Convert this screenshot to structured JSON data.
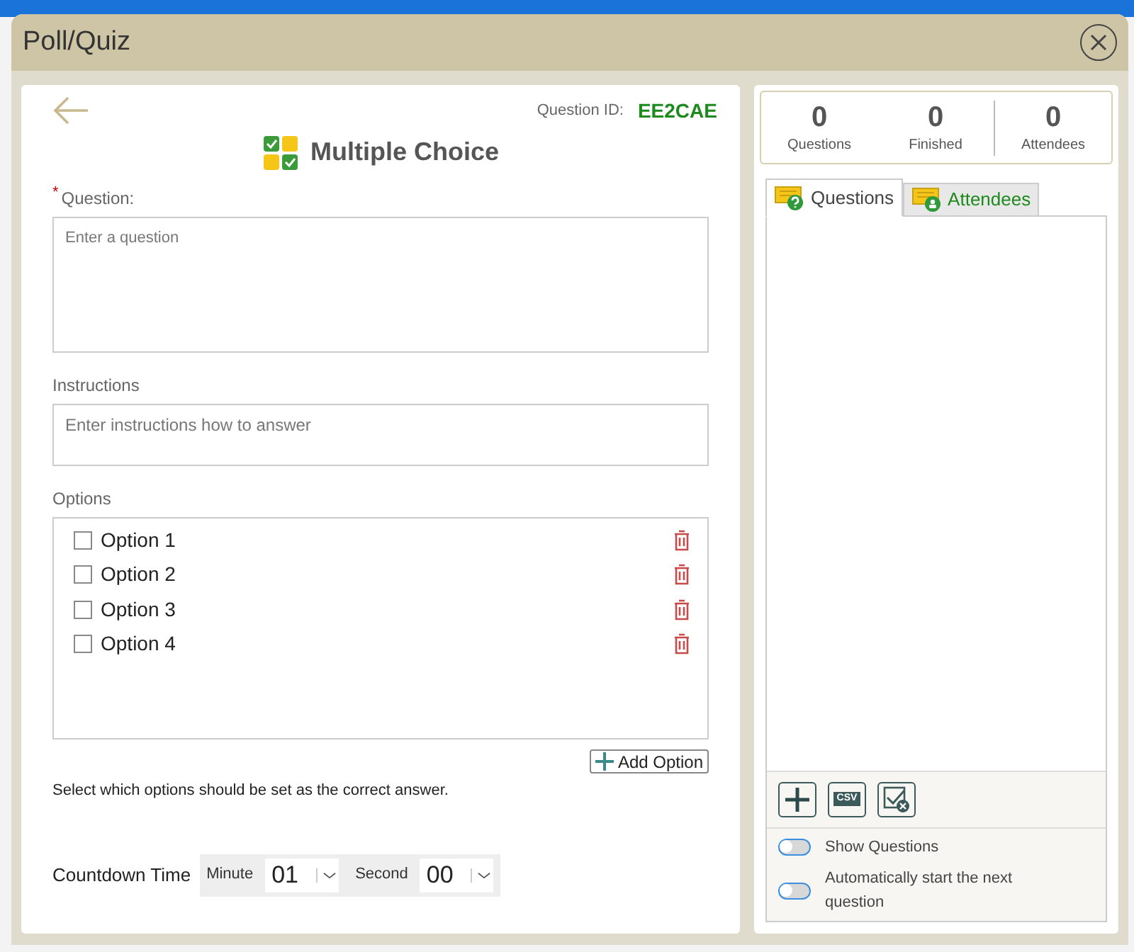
{
  "window": {
    "title": "Poll/Quiz"
  },
  "question_id": {
    "label": "Question ID:",
    "value": "EE2CAE"
  },
  "heading": "Multiple Choice",
  "question": {
    "label": "Question:",
    "required_mark": "*",
    "placeholder": "Enter a question"
  },
  "instructions": {
    "label": "Instructions",
    "placeholder": "Enter instructions how to answer"
  },
  "options": {
    "label": "Options",
    "items": [
      {
        "text": "Option 1",
        "checked": false
      },
      {
        "text": "Option 2",
        "checked": false
      },
      {
        "text": "Option 3",
        "checked": false
      },
      {
        "text": "Option 4",
        "checked": false
      }
    ],
    "add_button": "Add Option",
    "hint": "Select which options should be set as the correct answer."
  },
  "countdown": {
    "label": "Countdown Time",
    "minute_label": "Minute",
    "minute": "01",
    "second_label": "Second",
    "second": "00"
  },
  "stats": [
    {
      "value": "0",
      "label": "Questions"
    },
    {
      "value": "0",
      "label": "Finished"
    },
    {
      "value": "0",
      "label": "Attendees"
    }
  ],
  "tabs": [
    {
      "label": "Questions",
      "selected": true,
      "kind": "questions"
    },
    {
      "label": "Attendees",
      "selected": false,
      "kind": "attendees"
    }
  ],
  "toolbar": {
    "csv_label": "CSV"
  },
  "toggles": [
    {
      "label": "Show Questions",
      "on": false
    },
    {
      "label": "Automatically start the next question",
      "on": false
    }
  ]
}
